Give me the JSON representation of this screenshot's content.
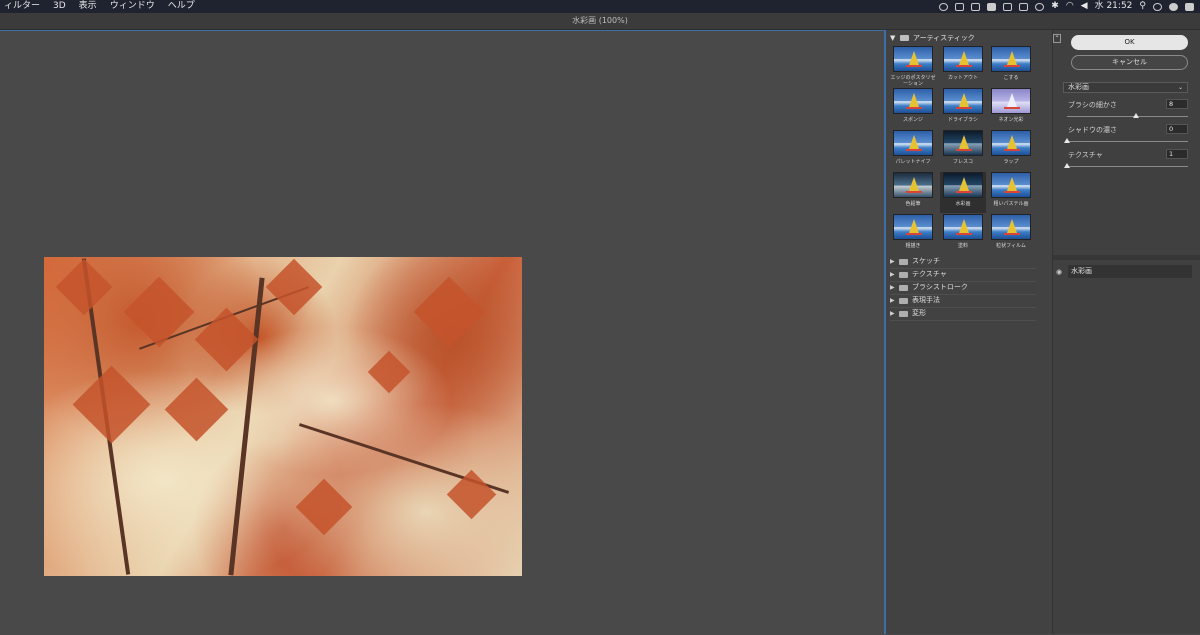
{
  "menubar": {
    "items": [
      "ィルター",
      "3D",
      "表示",
      "ウィンドウ",
      "ヘルプ"
    ],
    "clock": "水 21:52"
  },
  "window": {
    "title": "水彩画 (100%)"
  },
  "filter_gallery": {
    "open_category": "アーティスティック",
    "thumbnails": [
      {
        "label": "エッジのポスタリゼーション",
        "style": "normal"
      },
      {
        "label": "カットアウト",
        "style": "normal"
      },
      {
        "label": "こする",
        "style": "normal"
      },
      {
        "label": "スポンジ",
        "style": "normal"
      },
      {
        "label": "ドライブラシ",
        "style": "normal"
      },
      {
        "label": "ネオン光彩",
        "style": "neon"
      },
      {
        "label": "パレットナイフ",
        "style": "normal"
      },
      {
        "label": "フレスコ",
        "style": "dark"
      },
      {
        "label": "ラップ",
        "style": "normal"
      },
      {
        "label": "色鉛筆",
        "style": "muddy"
      },
      {
        "label": "水彩画",
        "style": "dark",
        "selected": true
      },
      {
        "label": "粗いパステル画",
        "style": "normal"
      },
      {
        "label": "粗描き",
        "style": "normal"
      },
      {
        "label": "塗料",
        "style": "normal"
      },
      {
        "label": "粒状フィルム",
        "style": "normal"
      }
    ],
    "other_categories": [
      "スケッチ",
      "テクスチャ",
      "ブラシストローク",
      "表現手法",
      "変形"
    ]
  },
  "settings": {
    "ok_label": "OK",
    "cancel_label": "キャンセル",
    "selected_filter": "水彩画",
    "params": [
      {
        "label": "ブラシの細かさ",
        "value": "8",
        "fraction": 0.57
      },
      {
        "label": "シャドウの濃さ",
        "value": "0",
        "fraction": 0.0
      },
      {
        "label": "テクスチャ",
        "value": "1",
        "fraction": 0.0
      }
    ],
    "layer_name": "水彩画"
  },
  "colors": {
    "accent": "#3c6fa8",
    "panel": "#424242",
    "canvas": "#494949"
  }
}
